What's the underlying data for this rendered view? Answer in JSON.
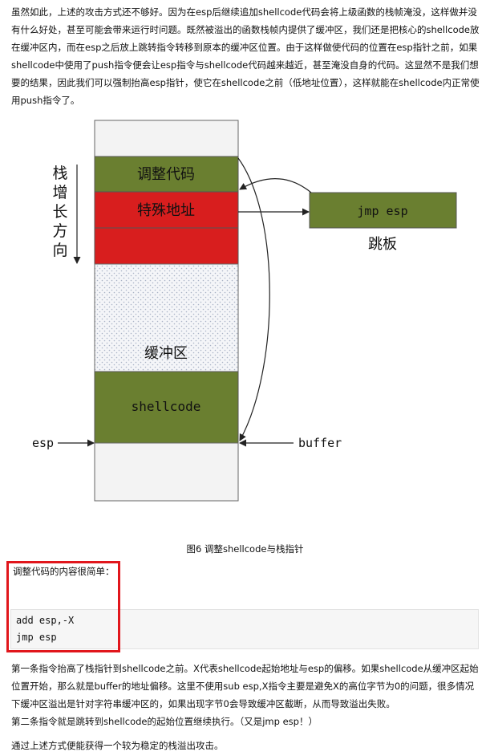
{
  "para1": "虽然如此，上述的攻击方式还不够好。因为在esp后继续追加shellcode代码会将上级函数的栈帧淹没，这样做并没有什么好处，甚至可能会带来运行时问题。既然被溢出的函数栈帧内提供了缓冲区，我们还是把核心的shellcode放在缓冲区内，而在esp之后放上跳转指令转移到原本的缓冲区位置。由于这样做使代码的位置在esp指针之前，如果shellcode中使用了push指令便会让esp指令与shellcode代码越来越近，甚至淹没自身的代码。这显然不是我们想要的结果，因此我们可以强制抬高esp指针，使它在shellcode之前（低地址位置），这样就能在shellcode内正常使用push指令了。",
  "figure": {
    "direction_chars": [
      "栈",
      "增",
      "长",
      "方",
      "向"
    ],
    "blocks": {
      "adjust": "调整代码",
      "special": "特殊地址",
      "buffer": "缓冲区",
      "shellcode": "shellcode"
    },
    "jmp_box": "jmp esp",
    "trampoline": "跳板",
    "esp_label": "esp",
    "buffer_label": "buffer",
    "colors": {
      "green": "#6a7f30",
      "red": "#d81e1e",
      "gray": "#f3f3f3"
    }
  },
  "caption": "图6 调整shellcode与栈指针",
  "code_intro": "调整代码的内容很简单：",
  "code_lines": [
    "add esp,-X",
    "jmp esp"
  ],
  "para2": "第一条指令抬高了栈指针到shellcode之前。X代表shellcode起始地址与esp的偏移。如果shellcode从缓冲区起始位置开始，那么就是buffer的地址偏移。这里不使用sub esp,X指令主要是避免X的高位字节为0的问题，很多情况下缓冲区溢出是针对字符串缓冲区的，如果出现字节0会导致缓冲区截断，从而导致溢出失败。",
  "para3": "第二条指令就是跳转到shellcode的起始位置继续执行。（又是jmp esp！）",
  "para4": "通过上述方式便能获得一个较为稳定的栈溢出攻击。"
}
